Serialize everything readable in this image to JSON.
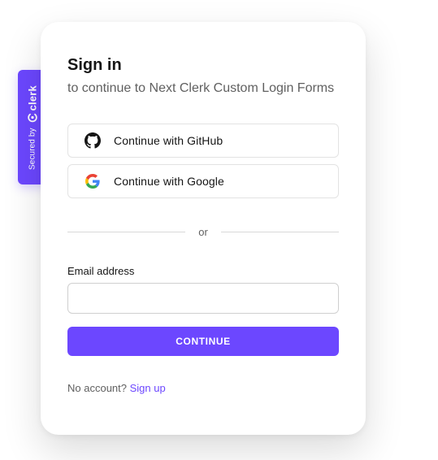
{
  "badge": {
    "secured_text": "Secured by",
    "brand_name": "clerk",
    "brand_color": "#6c47ff"
  },
  "signin": {
    "title": "Sign in",
    "subtitle": "to continue to Next Clerk Custom Login Forms"
  },
  "social": [
    {
      "label": "Continue with GitHub",
      "icon": "github-icon"
    },
    {
      "label": "Continue with Google",
      "icon": "google-icon"
    }
  ],
  "divider": {
    "text": "or"
  },
  "email": {
    "label": "Email address",
    "value": "",
    "placeholder": ""
  },
  "continue_button": {
    "label": "CONTINUE"
  },
  "footer": {
    "prompt": "No account?",
    "link": "Sign up"
  },
  "colors": {
    "accent": "#6c47ff",
    "text": "#151515",
    "muted": "#606060"
  }
}
